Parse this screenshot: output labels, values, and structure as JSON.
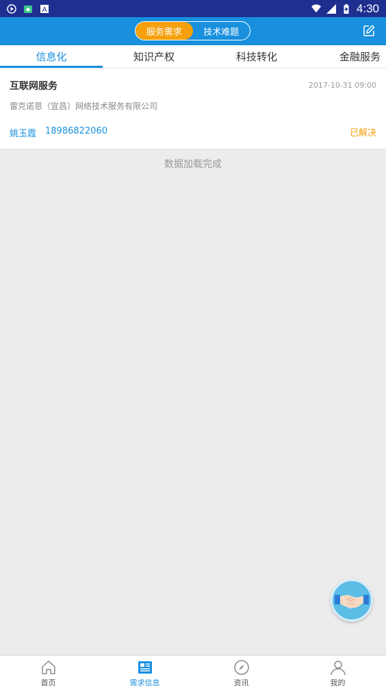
{
  "status_bar": {
    "time": "4:30"
  },
  "header": {
    "segments": [
      {
        "label": "服务需求",
        "active": true
      },
      {
        "label": "技术难题",
        "active": false
      }
    ],
    "edit_icon": "edit-icon"
  },
  "tabs": [
    {
      "label": "信息化",
      "active": true
    },
    {
      "label": "知识产权",
      "active": false
    },
    {
      "label": "科技转化",
      "active": false
    },
    {
      "label": "金融服务",
      "active": false
    }
  ],
  "card": {
    "title": "互联网服务",
    "time": "2017-10-31 09:00",
    "company": "雷克诺恩（宜昌）网络技术服务有限公司",
    "person": "姚玉霞",
    "phone": "18986822060",
    "status": "已解决"
  },
  "load_message": "数据加载完成",
  "bottom_nav": [
    {
      "label": "首页",
      "icon": "home-icon",
      "active": false
    },
    {
      "label": "需求信息",
      "icon": "news-icon",
      "active": true
    },
    {
      "label": "资讯",
      "icon": "compass-icon",
      "active": false
    },
    {
      "label": "我的",
      "icon": "person-icon",
      "active": false
    }
  ],
  "colors": {
    "primary": "#1890de",
    "accent": "#f5a00c",
    "status_bar": "#1f2f8f"
  }
}
